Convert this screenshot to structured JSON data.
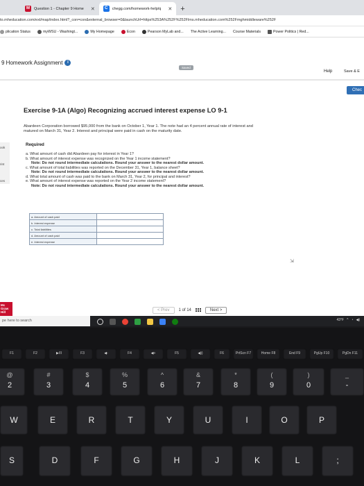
{
  "browser": {
    "tabs": [
      {
        "label": "Question 1 - Chapter 9 Home",
        "icon": "m-icon",
        "color": "#c8102e",
        "active": false
      },
      {
        "label": "chegg.com/homework-help/q",
        "icon": "chegg-icon",
        "color": "#1a73e8",
        "active": true
      }
    ],
    "new_tab": "+",
    "address": "to.mheducation.com/ext/map/index.html?_con=con&external_browser=0&launchUrl=https%253A%252F%252Flms.mheducation.com%252Fmghmiddleware%252F",
    "bookmarks": [
      {
        "label": "plication Status",
        "color": "#999"
      },
      {
        "label": "myWSU - Washingt...",
        "color": "#555"
      },
      {
        "label": "My Homepage",
        "color": "#2b6cb0"
      },
      {
        "label": "Econ",
        "color": "#c8102e"
      },
      {
        "label": "Pearson MyLab and...",
        "color": "#333"
      },
      {
        "label": "The Active Learning...",
        "color": "#777"
      },
      {
        "label": "Course Materials",
        "color": "#555"
      },
      {
        "label": "Power Politics | Red...",
        "color": "#555"
      }
    ]
  },
  "header": {
    "assignment_title": "9 Homework Assignment",
    "saved_label": "Saved",
    "help_label": "Help",
    "save_exit_label": "Save & E",
    "check_label": "Chec"
  },
  "rail": [
    "ook",
    "rint",
    "ces"
  ],
  "mcgraw": "Mc Graw Hill",
  "exercise": {
    "title": "Exercise 9-1A (Algo) Recognizing accrued interest expense LO 9-1",
    "problem_line1": "Abardeen Corporation borrowed $95,000 from the bank on October 1, Year 1. The note had an 4 percent annual rate of interest and",
    "problem_line2": "matured on March 31, Year 2. Interest and principal were paid in cash on the maturity date.",
    "required_label": "Required",
    "questions": [
      {
        "text": "a. What amount of cash did Abardeen pay for interest in Year 1?",
        "note": ""
      },
      {
        "text": "b. What amount of interest expense was recognized on the Year 1 income statement?",
        "note": "Note: Do not round intermediate calculations. Round your answer to the nearest dollar amount."
      },
      {
        "text": "c. What amount of total liabilities was reported on the December 31, Year 1, balance sheet?",
        "note": "Note: Do not round intermediate calculations. Round your answer to the nearest dollar amount."
      },
      {
        "text": "d. What total amount of cash was paid to the bank on March 31, Year 2, for principal and interest?",
        "note": ""
      },
      {
        "text": "e. What amount of interest expense was reported on the Year 2 income statement?",
        "note": "Note: Do not round intermediate calculations. Round your answer to the nearest dollar amount."
      }
    ],
    "answer_rows": [
      {
        "label": "a. Amount of cash paid",
        "value": ""
      },
      {
        "label": "b. Interest expense",
        "value": ""
      },
      {
        "label": "c. Total liabilities",
        "value": ""
      },
      {
        "label": "d. Amount of cash paid",
        "value": ""
      },
      {
        "label": "e. Interest expense",
        "value": ""
      }
    ]
  },
  "pager": {
    "prev_label": "< Prev",
    "position": "1 of 14",
    "next_label": "Next >"
  },
  "taskbar": {
    "search_placeholder": "pe here to search",
    "tray": "43°F"
  },
  "keyboard": {
    "frow": [
      "F1",
      "F2",
      "▶/II",
      "F3",
      "◀-",
      "F4",
      "◀+",
      "F5",
      "◀))",
      "F6",
      "PrtScn F7",
      "Home F8",
      "End F9",
      "PgUp F10",
      "PgDn F11"
    ],
    "nrow": [
      {
        "top": "@",
        "bot": "2"
      },
      {
        "top": "#",
        "bot": "3"
      },
      {
        "top": "$",
        "bot": "4"
      },
      {
        "top": "%",
        "bot": "5"
      },
      {
        "top": "^",
        "bot": "6"
      },
      {
        "top": "&",
        "bot": "7"
      },
      {
        "top": "*",
        "bot": "8"
      },
      {
        "top": "(",
        "bot": "9"
      },
      {
        "top": ")",
        "bot": "0"
      },
      {
        "top": "_",
        "bot": "-"
      }
    ],
    "arow": [
      "W",
      "E",
      "R",
      "T",
      "Y",
      "U",
      "I",
      "O",
      "P"
    ],
    "hrow": [
      "S",
      "D",
      "F",
      "G",
      "H",
      "J",
      "K",
      "L",
      ";"
    ]
  }
}
